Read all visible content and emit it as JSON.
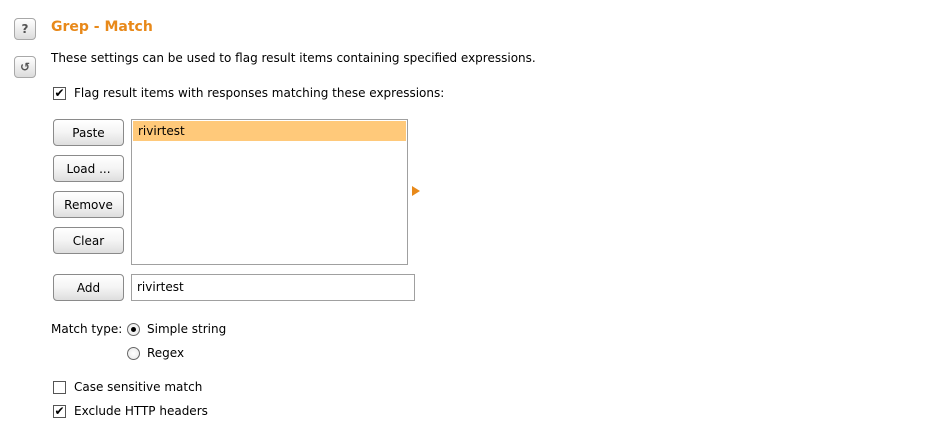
{
  "section": {
    "title": "Grep - Match",
    "description": "These settings can be used to flag result items containing specified expressions.",
    "help_icon": "?",
    "reset_icon": "↺"
  },
  "flag_option": {
    "label": "Flag result items with responses matching these expressions:",
    "checked": true
  },
  "buttons": {
    "paste": "Paste",
    "load": "Load ...",
    "remove": "Remove",
    "clear": "Clear",
    "add": "Add"
  },
  "expressions": [
    "rivirtest"
  ],
  "add_input": {
    "value": "rivirtest"
  },
  "match_type": {
    "label": "Match type:",
    "options": [
      "Simple string",
      "Regex"
    ],
    "selected": "Simple string"
  },
  "case_sensitive": {
    "label": "Case sensitive match",
    "checked": false
  },
  "exclude_headers": {
    "label": "Exclude HTTP headers",
    "checked": true
  },
  "colors": {
    "accent": "#e8891a",
    "selection": "#ffc97a"
  }
}
